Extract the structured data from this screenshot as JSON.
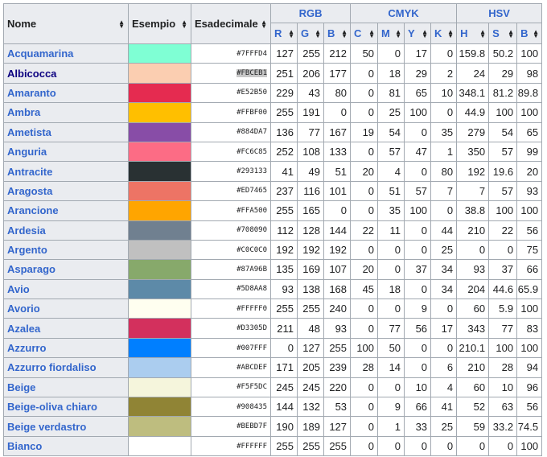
{
  "header": {
    "name": "Nome",
    "example": "Esempio",
    "hex": "Esadecimale",
    "rgb": "RGB",
    "cmyk": "CMYK",
    "hsv": "HSV",
    "sub": [
      "R",
      "G",
      "B",
      "C",
      "M",
      "Y",
      "K",
      "H",
      "S",
      "B"
    ]
  },
  "rows": [
    {
      "name": "Acquamarina",
      "color": "#7FFFD4",
      "hex": "#7FFFD4",
      "v": [
        "127",
        "255",
        "212",
        "50",
        "0",
        "17",
        "0",
        "159.8",
        "50.2",
        "100"
      ]
    },
    {
      "name": "Albicocca",
      "color": "#FBCEB1",
      "hex": "#FBCEB1",
      "v": [
        "251",
        "206",
        "177",
        "0",
        "18",
        "29",
        "2",
        "24",
        "29",
        "98"
      ]
    },
    {
      "name": "Amaranto",
      "color": "#E52B50",
      "hex": "#E52B50",
      "v": [
        "229",
        "43",
        "80",
        "0",
        "81",
        "65",
        "10",
        "348.1",
        "81.2",
        "89.8"
      ]
    },
    {
      "name": "Ambra",
      "color": "#FFBF00",
      "hex": "#FFBF00",
      "v": [
        "255",
        "191",
        "0",
        "0",
        "25",
        "100",
        "0",
        "44.9",
        "100",
        "100"
      ]
    },
    {
      "name": "Ametista",
      "color": "#884DA7",
      "hex": "#884DA7",
      "v": [
        "136",
        "77",
        "167",
        "19",
        "54",
        "0",
        "35",
        "279",
        "54",
        "65"
      ]
    },
    {
      "name": "Anguria",
      "color": "#FC6C85",
      "hex": "#FC6C85",
      "v": [
        "252",
        "108",
        "133",
        "0",
        "57",
        "47",
        "1",
        "350",
        "57",
        "99"
      ]
    },
    {
      "name": "Antracite",
      "color": "#293133",
      "hex": "#293133",
      "v": [
        "41",
        "49",
        "51",
        "20",
        "4",
        "0",
        "80",
        "192",
        "19.6",
        "20"
      ]
    },
    {
      "name": "Aragosta",
      "color": "#ED7465",
      "hex": "#ED7465",
      "v": [
        "237",
        "116",
        "101",
        "0",
        "51",
        "57",
        "7",
        "7",
        "57",
        "93"
      ]
    },
    {
      "name": "Arancione",
      "color": "#FFA500",
      "hex": "#FFA500",
      "v": [
        "255",
        "165",
        "0",
        "0",
        "35",
        "100",
        "0",
        "38.8",
        "100",
        "100"
      ]
    },
    {
      "name": "Ardesia",
      "color": "#708090",
      "hex": "#708090",
      "v": [
        "112",
        "128",
        "144",
        "22",
        "11",
        "0",
        "44",
        "210",
        "22",
        "56"
      ]
    },
    {
      "name": "Argento",
      "color": "#C0C0C0",
      "hex": "#C0C0C0",
      "v": [
        "192",
        "192",
        "192",
        "0",
        "0",
        "0",
        "25",
        "0",
        "0",
        "75"
      ]
    },
    {
      "name": "Asparago",
      "color": "#87A96B",
      "hex": "#87A96B",
      "v": [
        "135",
        "169",
        "107",
        "20",
        "0",
        "37",
        "34",
        "93",
        "37",
        "66"
      ]
    },
    {
      "name": "Avio",
      "color": "#5D8AA8",
      "hex": "#5D8AA8",
      "v": [
        "93",
        "138",
        "168",
        "45",
        "18",
        "0",
        "34",
        "204",
        "44.6",
        "65.9"
      ]
    },
    {
      "name": "Avorio",
      "color": "#FFFFF0",
      "hex": "#FFFFF0",
      "v": [
        "255",
        "255",
        "240",
        "0",
        "0",
        "9",
        "0",
        "60",
        "5.9",
        "100"
      ]
    },
    {
      "name": "Azalea",
      "color": "#D3305D",
      "hex": "#D3305D",
      "v": [
        "211",
        "48",
        "93",
        "0",
        "77",
        "56",
        "17",
        "343",
        "77",
        "83"
      ]
    },
    {
      "name": "Azzurro",
      "color": "#007FFF",
      "hex": "#007FFF",
      "v": [
        "0",
        "127",
        "255",
        "100",
        "50",
        "0",
        "0",
        "210.1",
        "100",
        "100"
      ]
    },
    {
      "name": "Azzurro fiordaliso",
      "color": "#ABCDEF",
      "hex": "#ABCDEF",
      "v": [
        "171",
        "205",
        "239",
        "28",
        "14",
        "0",
        "6",
        "210",
        "28",
        "94"
      ]
    },
    {
      "name": "Beige",
      "color": "#F5F5DC",
      "hex": "#F5F5DC",
      "v": [
        "245",
        "245",
        "220",
        "0",
        "0",
        "10",
        "4",
        "60",
        "10",
        "96"
      ]
    },
    {
      "name": "Beige-oliva chiaro",
      "color": "#908435",
      "hex": "#908435",
      "v": [
        "144",
        "132",
        "53",
        "0",
        "9",
        "66",
        "41",
        "52",
        "63",
        "56"
      ]
    },
    {
      "name": "Beige verdastro",
      "color": "#BEBD7F",
      "hex": "#BEBD7F",
      "v": [
        "190",
        "189",
        "127",
        "0",
        "1",
        "33",
        "25",
        "59",
        "33.2",
        "74.5"
      ]
    },
    {
      "name": "Bianco",
      "color": "#FFFFFF",
      "hex": "#FFFFFF",
      "v": [
        "255",
        "255",
        "255",
        "0",
        "0",
        "0",
        "0",
        "0",
        "0",
        "100"
      ]
    }
  ]
}
